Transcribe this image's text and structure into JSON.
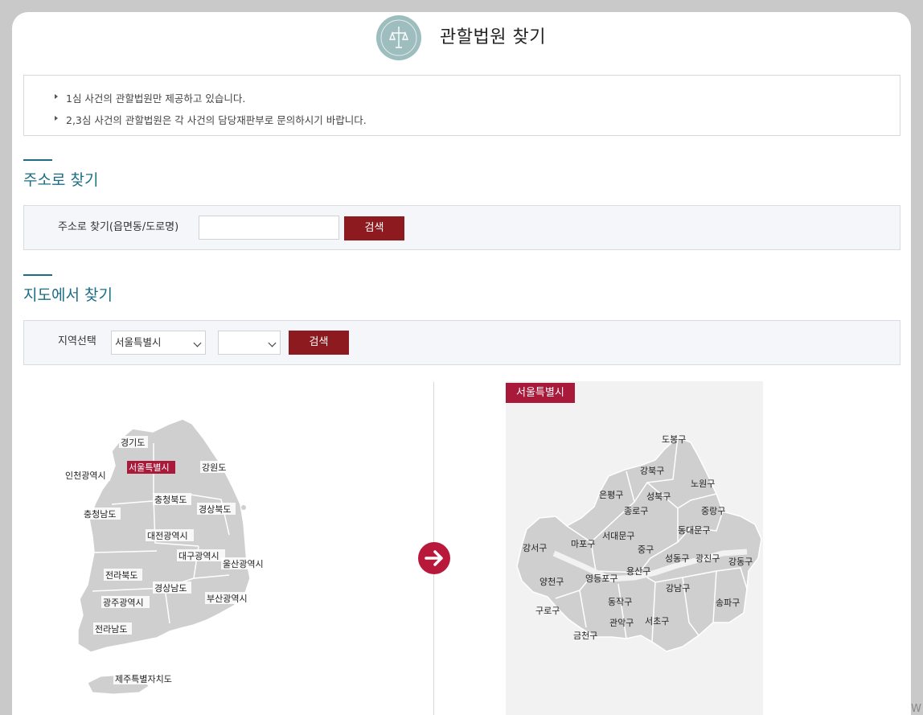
{
  "page_title": "관할법원 찾기",
  "notices": [
    "1심 사건의 관할법원만 제공하고 있습니다.",
    "2,3심 사건의 관할법원은 각 사건의 담당재판부로 문의하시기 바랍니다."
  ],
  "address_search": {
    "section_title": "주소로 찾기",
    "label": "주소로 찾기(읍면동/도로명)",
    "input_value": "",
    "button_label": "검색"
  },
  "map_search": {
    "section_title": "지도에서 찾기",
    "label": "지역선택",
    "region_select_value": "서울특별시",
    "district_select_value": "",
    "button_label": "검색"
  },
  "korea_map": {
    "selected_region": "서울특별시",
    "regions": [
      "경기도",
      "서울특별시",
      "인천광역시",
      "강원도",
      "충청북도",
      "충청남도",
      "경상북도",
      "대전광역시",
      "대구광역시",
      "울산광역시",
      "전라북도",
      "경상남도",
      "광주광역시",
      "부산광역시",
      "전라남도",
      "제주특별자치도"
    ]
  },
  "arrow_icon": "arrow-right-icon",
  "seoul_map": {
    "tag": "서울특별시",
    "districts": [
      "도봉구",
      "강북구",
      "노원구",
      "은평구",
      "성북구",
      "종로구",
      "중랑구",
      "동대문구",
      "서대문구",
      "강서구",
      "마포구",
      "중구",
      "성동구",
      "광진구",
      "강동구",
      "용산구",
      "양천구",
      "영등포구",
      "강남구",
      "동작구",
      "송파구",
      "구로구",
      "관악구",
      "서초구",
      "금천구"
    ]
  },
  "colors": {
    "accent": "#1c6e84",
    "button": "#8c1a1f",
    "highlight": "#a8193a",
    "map_fill": "#cfcfcf",
    "logo": "#9dbdbf"
  },
  "corner_text": "W"
}
